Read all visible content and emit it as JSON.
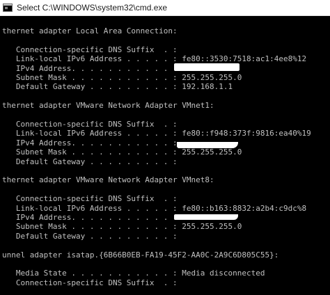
{
  "window": {
    "title": "Select C:\\WINDOWS\\system32\\cmd.exe",
    "icon": "cmd-icon"
  },
  "console": {
    "background": "#000000",
    "text_color": "#c0c0c0",
    "lines": [
      "thernet adapter Local Area Connection:",
      "",
      "   Connection-specific DNS Suffix  . :",
      "   Link-local IPv6 Address . . . . . : fe80::3530:7518:ac1:4ee8%12",
      "   IPv4 Address. . . . . . . . . . . :",
      "   Subnet Mask . . . . . . . . . . . : 255.255.255.0",
      "   Default Gateway . . . . . . . . . : 192.168.1.1",
      "",
      "thernet adapter VMware Network Adapter VMnet1:",
      "",
      "   Connection-specific DNS Suffix  . :",
      "   Link-local IPv6 Address . . . . . : fe80::f948:373f:9816:ea40%19",
      "   IPv4 Address. . . . . . . . . . . :",
      "   Subnet Mask . . . . . . . . . . . : 255.255.255.0",
      "   Default Gateway . . . . . . . . . :",
      "",
      "thernet adapter VMware Network Adapter VMnet8:",
      "",
      "   Connection-specific DNS Suffix  . :",
      "   Link-local IPv6 Address . . . . . : fe80::b163:8832:a2b4:c9dc%8",
      "   IPv4 Address. . . . . . . . . . . :",
      "   Subnet Mask . . . . . . . . . . . : 255.255.255.0",
      "   Default Gateway . . . . . . . . . :",
      "",
      "unnel adapter isatap.{6B66B0EB-FA19-45F2-AA0C-2A9C6D805C55}:",
      "",
      "   Media State . . . . . . . . . . . : Media disconnected",
      "   Connection-specific DNS Suffix  . :"
    ]
  }
}
